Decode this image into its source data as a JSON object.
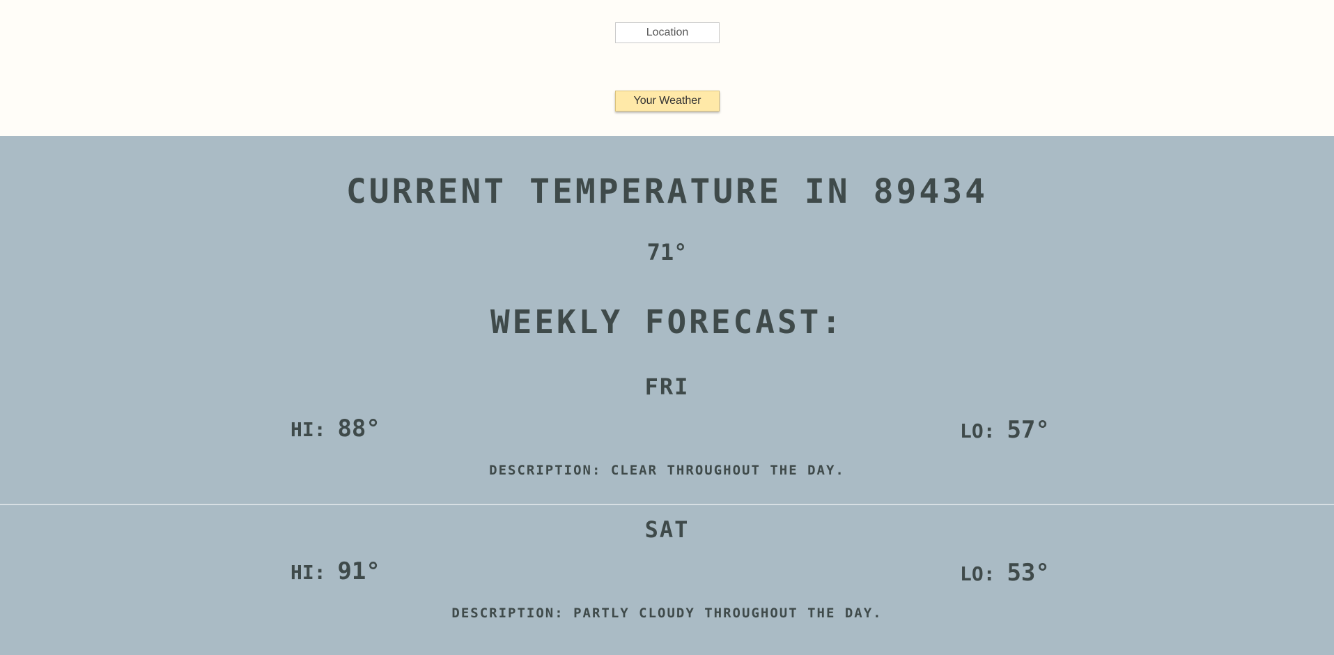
{
  "search": {
    "placeholder": "Location"
  },
  "actions": {
    "weather_button_label": "Your Weather"
  },
  "current": {
    "title_prefix": "Current Temperature in",
    "zip": "89434",
    "temperature": "71°"
  },
  "forecast": {
    "title": "Weekly Forecast:",
    "days": [
      {
        "day": "Fri",
        "hi_label": "Hi:",
        "hi": "88°",
        "lo_label": "Lo:",
        "lo": "57°",
        "description": "Description: Clear throughout the day."
      },
      {
        "day": "Sat",
        "hi_label": "Hi:",
        "hi": "91°",
        "lo_label": "Lo:",
        "lo": "53°",
        "description": "Description: Partly cloudy throughout the day."
      }
    ]
  },
  "colors": {
    "top_background": "#fffdf8",
    "panel_background": "#aabbc5",
    "button_background": "#ffe9a8",
    "text": "#3f4a4a"
  }
}
